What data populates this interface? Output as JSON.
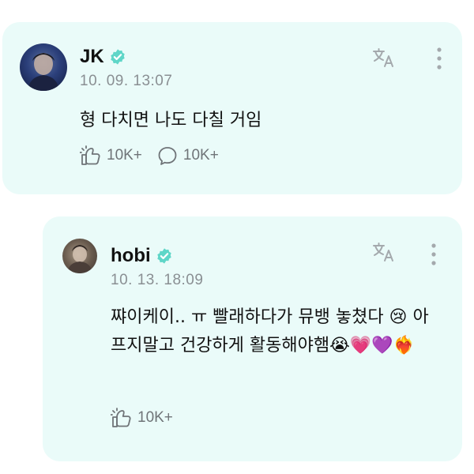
{
  "posts": [
    {
      "author": "JK",
      "timestamp": "10. 09. 13:07",
      "text": "형 다치면 나도 다칠 거임",
      "likes": "10K+",
      "comments": "10K+"
    },
    {
      "author": "hobi",
      "timestamp": "10. 13. 18:09",
      "text": "쨔이케이.. ㅠ 빨래하다가 뮤뱅 놓쳤다 😢 아프지말고 건강하게 활동해야햄😭💗💜❤️‍🔥",
      "likes": "10K+"
    }
  ],
  "colors": {
    "card_bg": "#eafbf9",
    "verified": "#5fd6c8",
    "muted": "#8a8f93",
    "icon": "#a4a9ad"
  },
  "icons": {
    "verified": "verified-badge-icon",
    "translate": "translate-icon",
    "more": "more-vertical-icon",
    "like": "like-icon",
    "comment": "comment-icon"
  }
}
